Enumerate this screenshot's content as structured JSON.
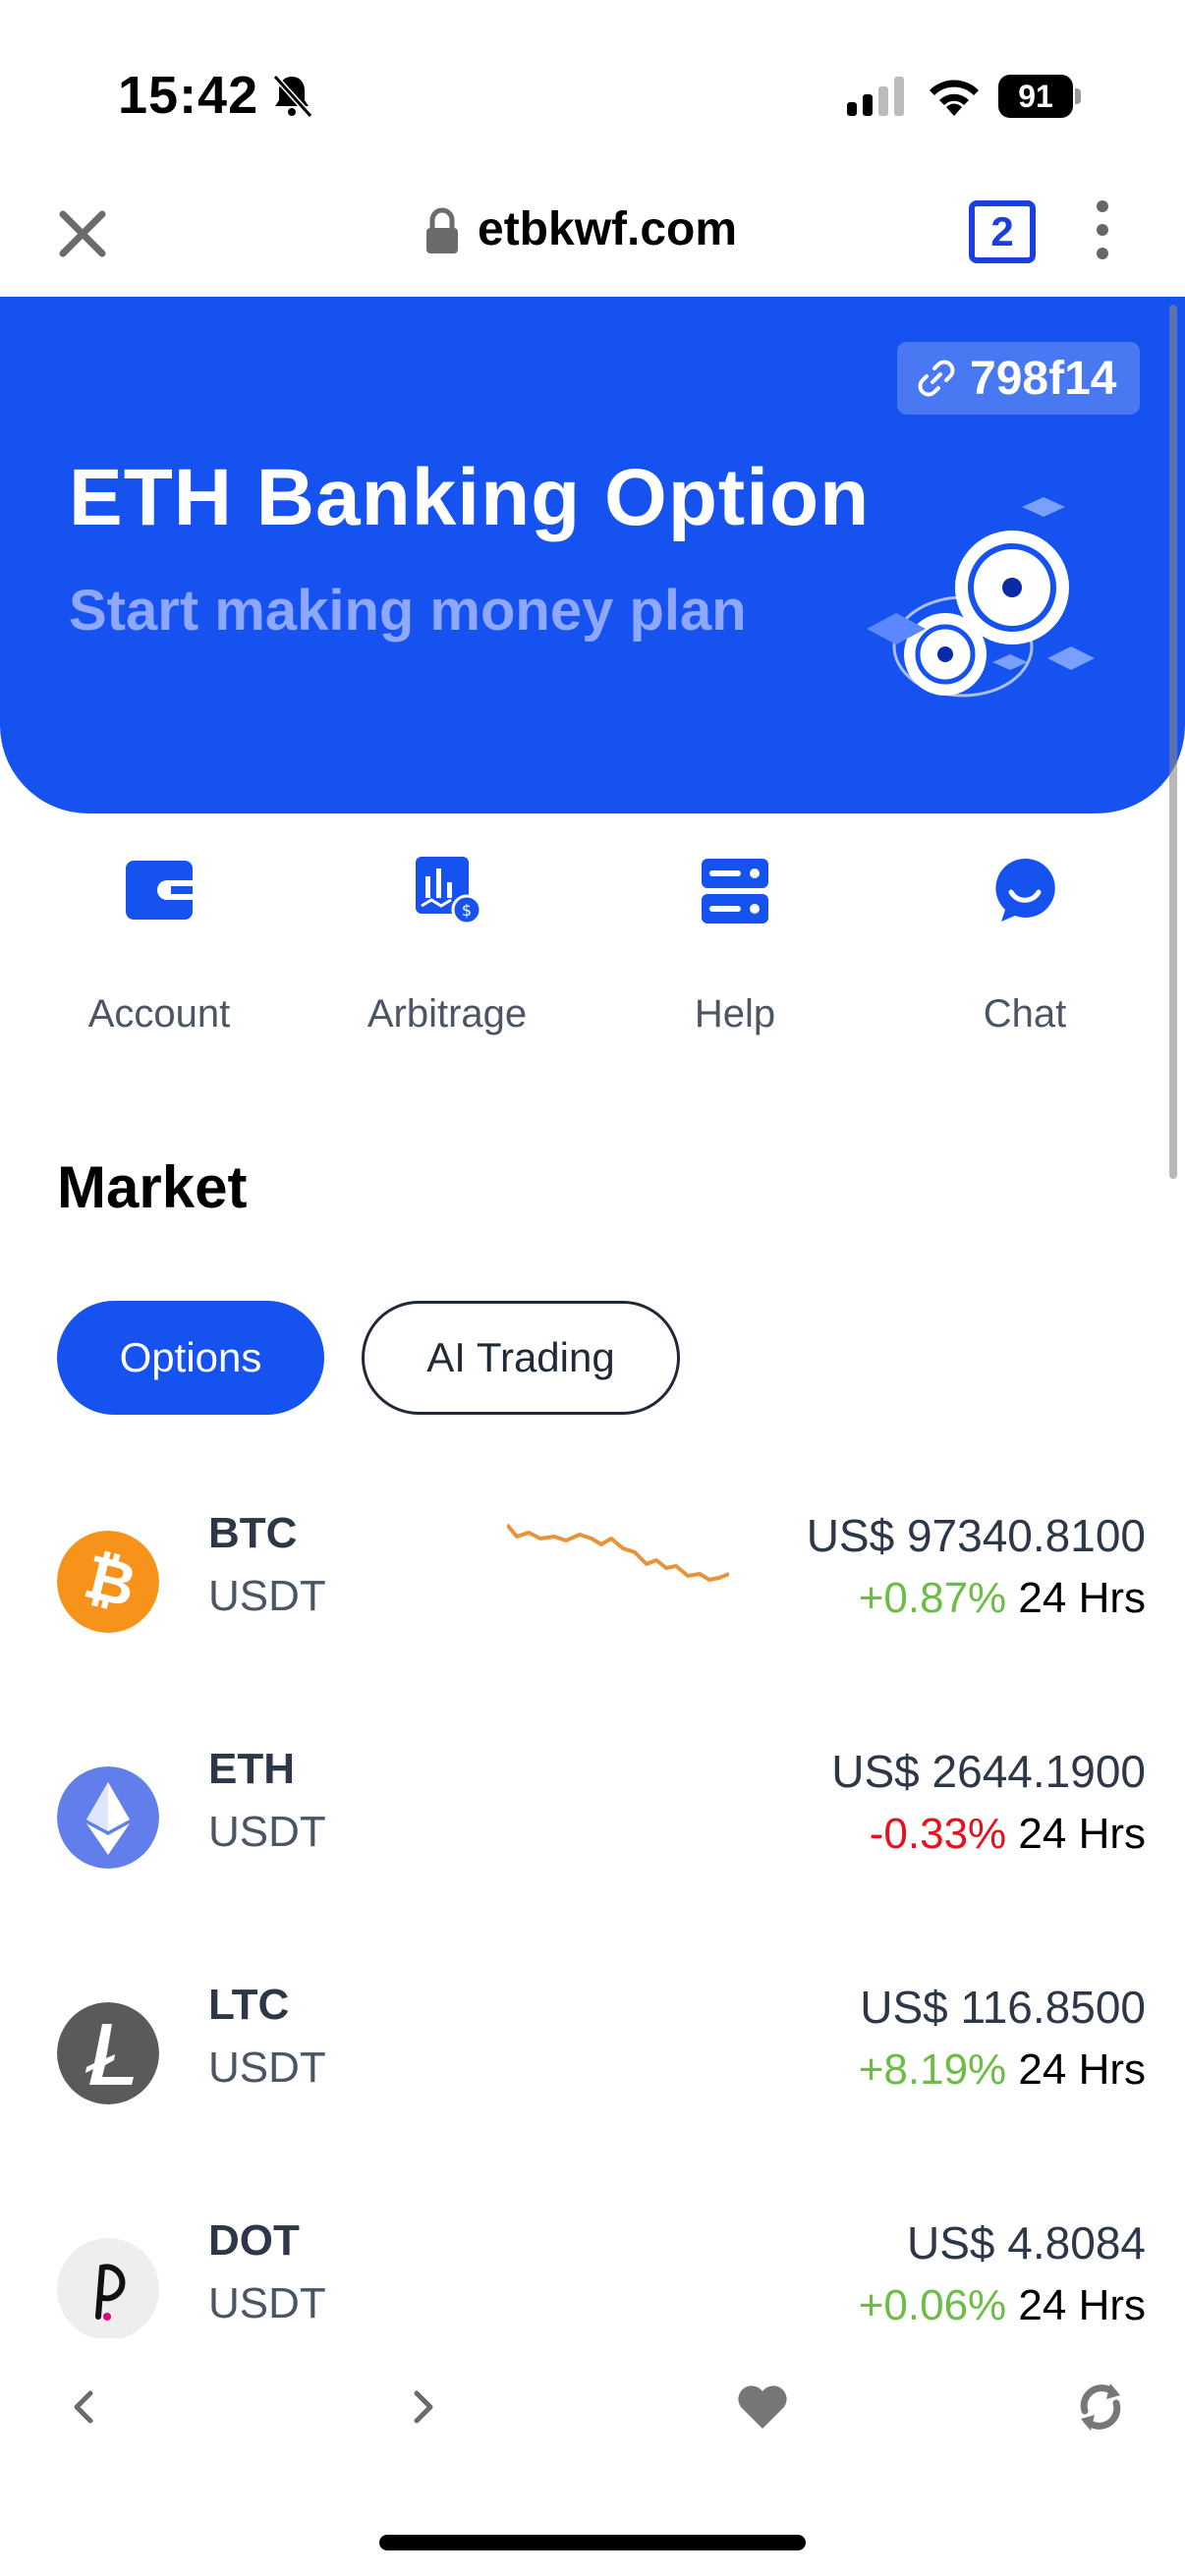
{
  "status_bar": {
    "time": "15:42",
    "battery": "91"
  },
  "browser": {
    "url": "etbkwf.com",
    "tab_count": "2"
  },
  "hero": {
    "invite_code": "798f14",
    "title": "ETH Banking Option",
    "subtitle": "Start making money plan"
  },
  "quick_actions": [
    {
      "label": "Account",
      "icon": "wallet-icon"
    },
    {
      "label": "Arbitrage",
      "icon": "chart-dollar-icon"
    },
    {
      "label": "Help",
      "icon": "server-icon"
    },
    {
      "label": "Chat",
      "icon": "chat-bubble-icon"
    }
  ],
  "market": {
    "title": "Market",
    "tabs": [
      "Options",
      "AI Trading"
    ],
    "active_tab": "Options",
    "change_suffix": "24 Hrs",
    "coins": [
      {
        "symbol": "BTC",
        "quote": "USDT",
        "price": "US$ 97340.8100",
        "change": "+0.87%",
        "direction": "up",
        "logo_color": "#f7931a"
      },
      {
        "symbol": "ETH",
        "quote": "USDT",
        "price": "US$ 2644.1900",
        "change": "-0.33%",
        "direction": "down",
        "logo_color": "#627eea"
      },
      {
        "symbol": "LTC",
        "quote": "USDT",
        "price": "US$ 116.8500",
        "change": "+8.19%",
        "direction": "up",
        "logo_color": "#5a5a5a"
      },
      {
        "symbol": "DOT",
        "quote": "USDT",
        "price": "US$ 4.8084",
        "change": "+0.06%",
        "direction": "up",
        "logo_color": "#eeeeee"
      }
    ]
  },
  "colors": {
    "primary": "#1652f0",
    "positive": "#6cbd45",
    "negative": "#e8101b",
    "sparkline": "#e8923a"
  }
}
